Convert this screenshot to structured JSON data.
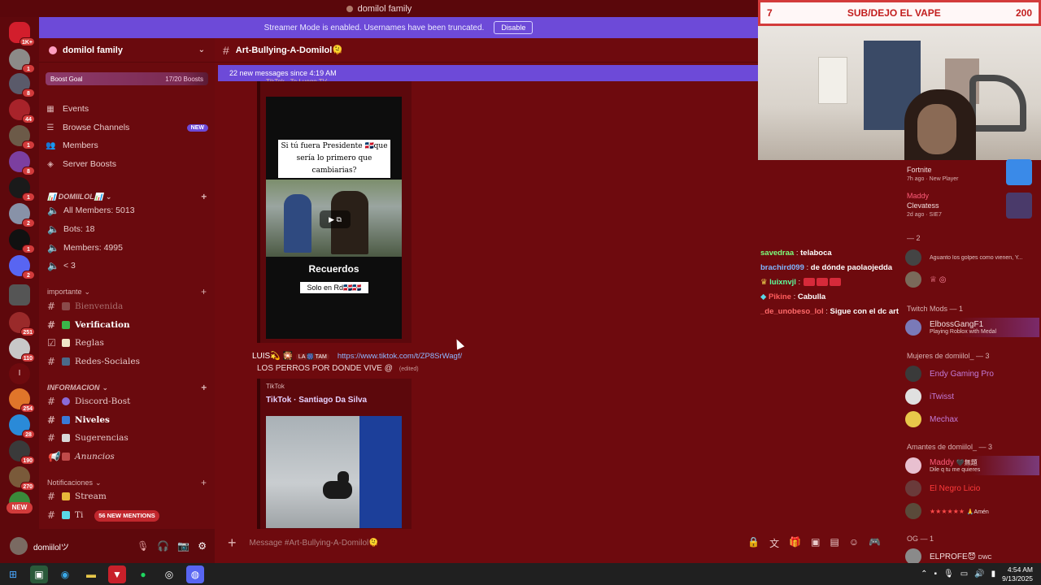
{
  "window": {
    "title": "domilol family"
  },
  "banner": {
    "text": "Streamer Mode is enabled. Usernames have been truncated.",
    "button": "Disable"
  },
  "server_rail": {
    "badges": [
      "1K+",
      "1",
      "8",
      "44",
      "1",
      "8",
      "1",
      "2",
      "1",
      "2",
      "251",
      "110",
      "I",
      "254",
      "28",
      "190",
      "270"
    ],
    "new_label": "NEW"
  },
  "guild": {
    "name": "domilol family",
    "boost_label": "Boost Goal",
    "boost_count": "17/20 Boosts",
    "boost_progress": 0.85,
    "nav": [
      {
        "label": "Events",
        "icon": "calendar-icon"
      },
      {
        "label": "Browse Channels",
        "icon": "browse-icon",
        "badge": "NEW"
      },
      {
        "label": "Members",
        "icon": "members-icon"
      },
      {
        "label": "Server Boosts",
        "icon": "boost-icon"
      }
    ]
  },
  "categories": {
    "domiilol": "📊 DOMIILOL📊",
    "importante": "importante",
    "informacion": "INFORMACION",
    "notificaciones": "Notificaciones"
  },
  "voice_stats": [
    "All Members: 5013",
    "Bots: 18",
    "Members: 4995",
    "< 3"
  ],
  "channels_importante": [
    "Bienvenida",
    "Verification",
    "Reglas",
    "Redes-Sociales"
  ],
  "channels_info": [
    "Discord-Bost",
    "Niveles",
    "Sugerencias",
    "Anuncios"
  ],
  "channels_notif": [
    "Stream",
    "Ti"
  ],
  "mentions_pill": "56 NEW MENTIONS",
  "user": {
    "name": "domiilolツ"
  },
  "chat": {
    "channel": "Art-Bullying-A-Domilol🫠",
    "new_messages": "22 new messages since 4:19 AM",
    "top_cut": "TikTok · Te Luego TV",
    "tiktok1": {
      "question": "Si tú fuera Presidente 🇩🇴que sería lo primero que cambiarias?",
      "title": "Recuerdos",
      "caption": "Solo en Rd🇩🇴🇩🇴"
    },
    "message": {
      "author": "LUIS💫 🎇",
      "tag": "LA 🎆 TAM",
      "link": "https://www.tiktok.com/t/ZP8SrWagf/",
      "text": "LOS PERROS POR DONDE VIVE @",
      "edited": "(edited)"
    },
    "embed2": {
      "provider": "TikTok",
      "title": "TikTok · Santiago Da Silva"
    },
    "composer_placeholder": "Message #Art-Bullying-A-Domilol🫠"
  },
  "overlay": {
    "left": "7",
    "title": "SUB/DEJO EL VAPE",
    "right": "200"
  },
  "twitch_chat": [
    {
      "user": "savedraa",
      "color": "#7cff7c",
      "text": "telaboca"
    },
    {
      "user": "brachird099",
      "color": "#7fb6ff",
      "text": "de dónde paolaojedda"
    },
    {
      "user": "luixnvjl",
      "color": "#5cff9d",
      "text": ""
    },
    {
      "user": "Pikine",
      "color": "#ff5c5c",
      "text": "Cabulla"
    },
    {
      "user": "_de_unobeso_lol",
      "color": "#ff6a6a",
      "text": "Sigue con el dc art"
    }
  ],
  "members": {
    "activity1": {
      "game": "Fortnite",
      "time": "7h ago",
      "note": "New Player"
    },
    "activity2": {
      "name": "Maddy",
      "game": "Clevatess",
      "time": "2d ago",
      "note": "SIE7"
    },
    "dash_group": "— 2",
    "dash_line": "Aguanto los golpes como vienen, Y...",
    "twitch_mods": "Twitch Mods — 1",
    "mod": {
      "name": "ElbossGangF1",
      "status": "Playing Roblox with Medal"
    },
    "mujeres": "Mujeres de domiilol_ — 3",
    "mujeres_list": [
      "Endy Gaming Pro",
      "iTwisst",
      "Mechax"
    ],
    "amantes": "Amantes de domiilol_ — 3",
    "amantes_list": [
      {
        "name": "Maddy",
        "status": "Dile q tu me quieres",
        "extra": "🖤無題"
      },
      {
        "name": "El Negro Licio",
        "status": ""
      },
      {
        "name": "★★★★★★",
        "status": "",
        "extra": "🙏Amén"
      }
    ],
    "og": "OG — 1",
    "og_member": {
      "name": "ELPROFE😈",
      "extra": "DWC"
    }
  },
  "taskbar": {
    "time": "4:54 AM",
    "date": "9/13/2025"
  }
}
